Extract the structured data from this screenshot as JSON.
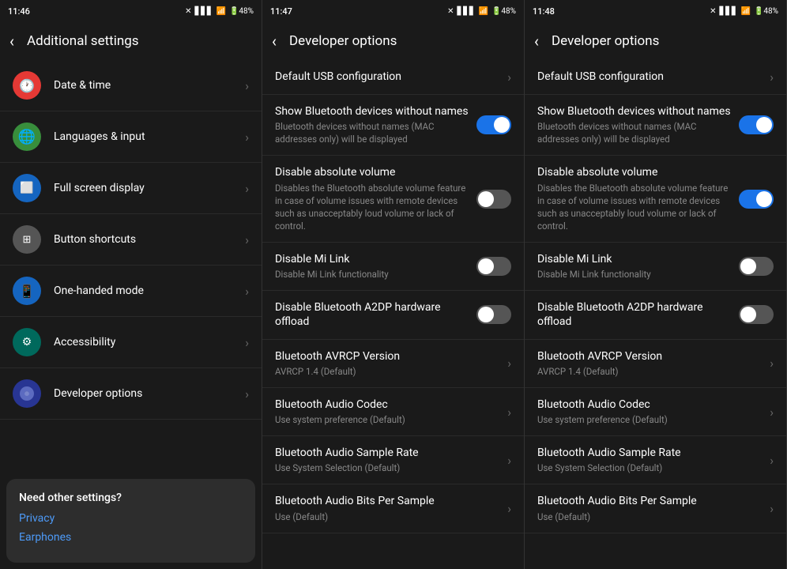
{
  "screens": [
    {
      "id": "additional-settings",
      "statusBar": {
        "time": "11:46",
        "icons": [
          "signal",
          "wifi",
          "battery"
        ]
      },
      "topBar": {
        "title": "Additional settings",
        "hasBack": true
      },
      "items": [
        {
          "id": "date-time",
          "icon": "🕐",
          "iconColor": "icon-red",
          "title": "Date & time",
          "subtitle": "",
          "type": "arrow"
        },
        {
          "id": "languages",
          "icon": "🌐",
          "iconColor": "icon-green",
          "title": "Languages & input",
          "subtitle": "",
          "type": "arrow"
        },
        {
          "id": "full-screen",
          "icon": "⬜",
          "iconColor": "icon-blue-light",
          "title": "Full screen display",
          "subtitle": "",
          "type": "arrow"
        },
        {
          "id": "button-shortcuts",
          "icon": "⊞",
          "iconColor": "icon-gray",
          "title": "Button shortcuts",
          "subtitle": "",
          "type": "arrow"
        },
        {
          "id": "one-handed",
          "icon": "📱",
          "iconColor": "icon-blue-light",
          "title": "One-handed mode",
          "subtitle": "",
          "type": "arrow"
        },
        {
          "id": "accessibility",
          "icon": "⚙",
          "iconColor": "icon-teal",
          "title": "Accessibility",
          "subtitle": "",
          "type": "arrow"
        },
        {
          "id": "developer",
          "icon": "◑",
          "iconColor": "icon-indigo",
          "title": "Developer options",
          "subtitle": "",
          "type": "arrow"
        }
      ],
      "bottomCard": {
        "title": "Need other settings?",
        "links": [
          "Privacy",
          "Earphones"
        ]
      }
    },
    {
      "id": "developer-options-1",
      "statusBar": {
        "time": "11:47",
        "icons": [
          "signal",
          "wifi",
          "battery"
        ]
      },
      "topBar": {
        "title": "Developer options",
        "hasBack": true
      },
      "devItems": [
        {
          "id": "usb-config",
          "title": "Default USB configuration",
          "subtitle": "",
          "type": "arrow"
        },
        {
          "id": "bluetooth-names",
          "title": "Show Bluetooth devices without names",
          "subtitle": "Bluetooth devices without names (MAC addresses only) will be displayed",
          "type": "toggle",
          "toggleState": "on"
        },
        {
          "id": "absolute-volume",
          "title": "Disable absolute volume",
          "subtitle": "Disables the Bluetooth absolute volume feature in case of volume issues with remote devices such as unacceptably loud volume or lack of control.",
          "type": "toggle",
          "toggleState": "off"
        },
        {
          "id": "mi-link",
          "title": "Disable Mi Link",
          "subtitle": "Disable Mi Link functionality",
          "type": "toggle",
          "toggleState": "off"
        },
        {
          "id": "a2dp",
          "title": "Disable Bluetooth A2DP hardware offload",
          "subtitle": "",
          "type": "toggle",
          "toggleState": "off"
        },
        {
          "id": "avrcp",
          "title": "Bluetooth AVRCP Version",
          "subtitle": "AVRCP 1.4 (Default)",
          "type": "arrow"
        },
        {
          "id": "audio-codec",
          "title": "Bluetooth Audio Codec",
          "subtitle": "Use system preference (Default)",
          "type": "arrow"
        },
        {
          "id": "sample-rate",
          "title": "Bluetooth Audio Sample Rate",
          "subtitle": "Use System Selection (Default)",
          "type": "arrow"
        },
        {
          "id": "bits-per-sample",
          "title": "Bluetooth Audio Bits Per Sample",
          "subtitle": "Use (Default)",
          "type": "arrow"
        }
      ]
    },
    {
      "id": "developer-options-2",
      "statusBar": {
        "time": "11:48",
        "icons": [
          "signal",
          "wifi",
          "battery"
        ]
      },
      "topBar": {
        "title": "Developer options",
        "hasBack": true
      },
      "devItems": [
        {
          "id": "usb-config2",
          "title": "Default USB configuration",
          "subtitle": "",
          "type": "arrow"
        },
        {
          "id": "bluetooth-names2",
          "title": "Show Bluetooth devices without names",
          "subtitle": "Bluetooth devices without names (MAC addresses only) will be displayed",
          "type": "toggle",
          "toggleState": "on"
        },
        {
          "id": "absolute-volume2",
          "title": "Disable absolute volume",
          "subtitle": "Disables the Bluetooth absolute volume feature in case of volume issues with remote devices such as unacceptably loud volume or lack of control.",
          "type": "toggle",
          "toggleState": "on"
        },
        {
          "id": "mi-link2",
          "title": "Disable Mi Link",
          "subtitle": "Disable Mi Link functionality",
          "type": "toggle",
          "toggleState": "off"
        },
        {
          "id": "a2dp2",
          "title": "Disable Bluetooth A2DP hardware offload",
          "subtitle": "",
          "type": "toggle",
          "toggleState": "off"
        },
        {
          "id": "avrcp2",
          "title": "Bluetooth AVRCP Version",
          "subtitle": "AVRCP 1.4 (Default)",
          "type": "arrow"
        },
        {
          "id": "audio-codec2",
          "title": "Bluetooth Audio Codec",
          "subtitle": "Use system preference (Default)",
          "type": "arrow"
        },
        {
          "id": "sample-rate2",
          "title": "Bluetooth Audio Sample Rate",
          "subtitle": "Use System Selection (Default)",
          "type": "arrow"
        },
        {
          "id": "bits-per-sample2",
          "title": "Bluetooth Audio Bits Per Sample",
          "subtitle": "Use (Default)",
          "type": "arrow"
        }
      ]
    }
  ]
}
